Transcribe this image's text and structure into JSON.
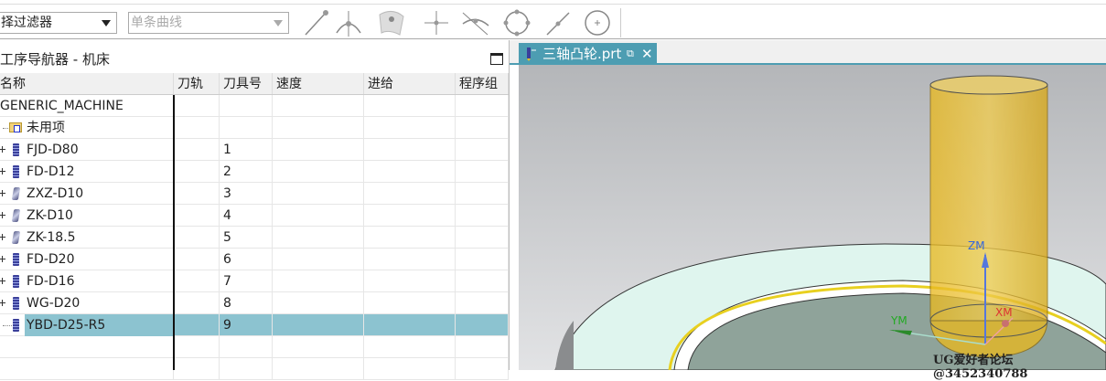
{
  "toolbar": {
    "filter_select": "择过滤器",
    "curve_rule": "单条曲线",
    "icons": [
      "line-endpoint-icon",
      "arc-center-icon",
      "surface-point-icon",
      "intersection-icon",
      "tangent-point-icon",
      "quadrant-point-icon",
      "midpoint-icon",
      "circle-center-icon"
    ]
  },
  "navigator": {
    "title": "工序导航器 - 机床",
    "columns": [
      "名称",
      "刀轨",
      "刀具号",
      "速度",
      "进给",
      "程序组"
    ],
    "rows": [
      {
        "name": "GENERIC_MACHINE",
        "tool_no": "",
        "kind": "root"
      },
      {
        "name": "未用项",
        "tool_no": "",
        "kind": "folder"
      },
      {
        "name": "FJD-D80",
        "tool_no": "1",
        "kind": "mill"
      },
      {
        "name": "FD-D12",
        "tool_no": "2",
        "kind": "mill"
      },
      {
        "name": "ZXZ-D10",
        "tool_no": "3",
        "kind": "drill"
      },
      {
        "name": "ZK-D10",
        "tool_no": "4",
        "kind": "drill"
      },
      {
        "name": "ZK-18.5",
        "tool_no": "5",
        "kind": "drill"
      },
      {
        "name": "FD-D20",
        "tool_no": "6",
        "kind": "mill"
      },
      {
        "name": "FD-D16",
        "tool_no": "7",
        "kind": "mill"
      },
      {
        "name": "WG-D20",
        "tool_no": "8",
        "kind": "mill"
      },
      {
        "name": "YBD-D25-R5",
        "tool_no": "9",
        "kind": "mill",
        "selected": true
      }
    ]
  },
  "document_tab": {
    "label": "三轴凸轮.prt"
  },
  "viewport": {
    "axes": {
      "z": "ZM",
      "x": "XM",
      "y": "YM"
    },
    "colors": {
      "tool": "#e8b820",
      "part_top": "#dff5ee",
      "floor": "#8fa39a",
      "accent": "#4d9db2"
    }
  },
  "watermark": "UG爱好者论坛@3452340788"
}
